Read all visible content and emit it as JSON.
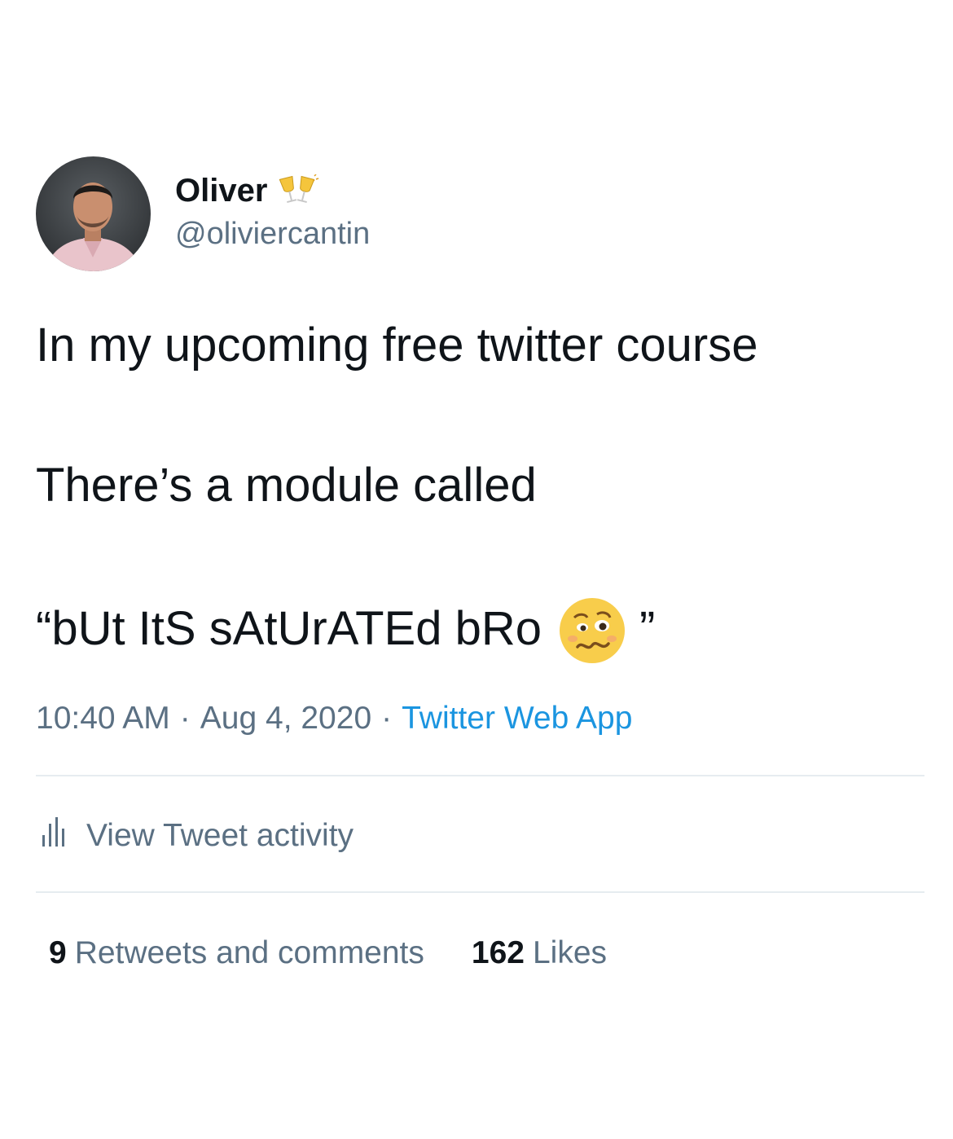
{
  "tweet": {
    "author": {
      "display_name": "Oliver",
      "name_emoji": "clinking-glasses-icon",
      "handle": "@oliviercantin"
    },
    "text_lines": [
      "In my upcoming free twitter course",
      "There’s a module called",
      "“bUt ItS sAtUrATEd bRo"
    ],
    "closing_quote": "”",
    "inline_emoji": "woozy-face-icon",
    "time": "10:40 AM",
    "separator": "·",
    "date": "Aug 4, 2020",
    "source": "Twitter Web App",
    "activity_label": "View Tweet activity",
    "retweets_count": "9",
    "retweets_label": "Retweets and comments",
    "likes_count": "162",
    "likes_label": "Likes"
  },
  "colors": {
    "text_primary": "#0f1419",
    "text_secondary": "#5b7083",
    "link": "#1b95e0",
    "divider": "#e6ecf0"
  }
}
